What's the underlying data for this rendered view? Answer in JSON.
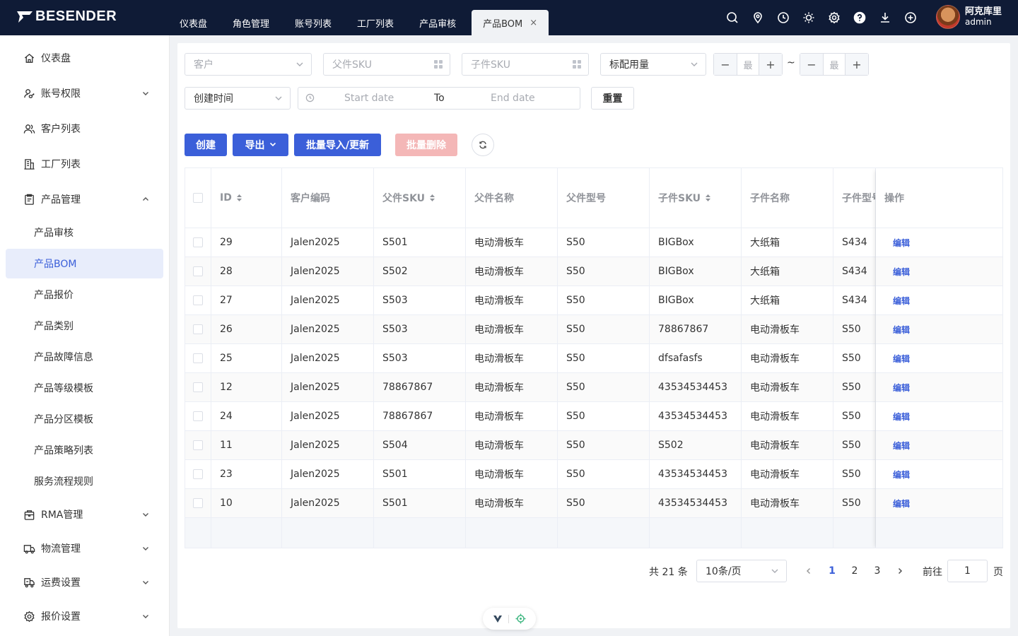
{
  "brand": {
    "name": "BESENDER"
  },
  "top_tabs": [
    {
      "label": "仪表盘"
    },
    {
      "label": "角色管理"
    },
    {
      "label": "账号列表"
    },
    {
      "label": "工厂列表"
    },
    {
      "label": "产品审核"
    },
    {
      "label": "产品BOM",
      "active": true,
      "close": "×"
    }
  ],
  "top_icons": [
    "search-icon",
    "location-icon",
    "clock-icon",
    "sun-icon",
    "gear-icon",
    "help-icon",
    "download-icon",
    "plus-circle-icon"
  ],
  "user": {
    "name": "阿克库里",
    "role": "admin"
  },
  "sidebar": {
    "items": [
      {
        "label": "仪表盘",
        "icon": "home-icon"
      },
      {
        "label": "账号权限",
        "icon": "user-key-icon"
      },
      {
        "label": "客户列表",
        "icon": "users-icon"
      },
      {
        "label": "工厂列表",
        "icon": "building-icon"
      },
      {
        "label": "产品管理",
        "icon": "clipboard-icon"
      }
    ],
    "sub_items": [
      {
        "label": "产品审核"
      },
      {
        "label": "产品BOM",
        "active": true
      },
      {
        "label": "产品报价"
      },
      {
        "label": "产品类别"
      },
      {
        "label": "产品故障信息"
      },
      {
        "label": "产品等级模板"
      },
      {
        "label": "产品分区模板"
      },
      {
        "label": "产品策略列表"
      },
      {
        "label": "服务流程规则"
      }
    ],
    "bottom_items": [
      {
        "label": "RMA管理",
        "icon": "box-icon"
      },
      {
        "label": "物流管理",
        "icon": "truck-icon"
      },
      {
        "label": "运费设置",
        "icon": "freight-icon"
      },
      {
        "label": "报价设置",
        "icon": "gear-icon"
      }
    ]
  },
  "filters": {
    "customer_placeholder": "客户",
    "parent_sku_placeholder": "父件SKU",
    "child_sku_placeholder": "子件SKU",
    "usage_select": "标配用量",
    "min_label": "最",
    "max_label": "最",
    "minus": "−",
    "plus": "+",
    "tilde": "~",
    "created_select": "创建时间",
    "start_date": "Start date",
    "to": "To",
    "end_date": "End date",
    "reset": "重置"
  },
  "actions": {
    "create": "创建",
    "export": "导出",
    "batch_import": "批量导入/更新",
    "batch_delete": "批量删除"
  },
  "table": {
    "headers": [
      "ID",
      "客户编码",
      "父件SKU",
      "父件名称",
      "父件型号",
      "子件SKU",
      "子件名称",
      "子件型号",
      "操作"
    ],
    "edit_label": "编辑",
    "rows": [
      [
        "29",
        "Jalen2025",
        "S501",
        "电动滑板车",
        "S50",
        "BIGBox",
        "大纸箱",
        "S434"
      ],
      [
        "28",
        "Jalen2025",
        "S502",
        "电动滑板车",
        "S50",
        "BIGBox",
        "大纸箱",
        "S434"
      ],
      [
        "27",
        "Jalen2025",
        "S503",
        "电动滑板车",
        "S50",
        "BIGBox",
        "大纸箱",
        "S434"
      ],
      [
        "26",
        "Jalen2025",
        "S503",
        "电动滑板车",
        "S50",
        "78867867",
        "电动滑板车",
        "S50"
      ],
      [
        "25",
        "Jalen2025",
        "S503",
        "电动滑板车",
        "S50",
        "dfsafasfs",
        "电动滑板车",
        "S50"
      ],
      [
        "12",
        "Jalen2025",
        "78867867",
        "电动滑板车",
        "S50",
        "43534534453",
        "电动滑板车",
        "S50"
      ],
      [
        "24",
        "Jalen2025",
        "78867867",
        "电动滑板车",
        "S50",
        "43534534453",
        "电动滑板车",
        "S50"
      ],
      [
        "11",
        "Jalen2025",
        "S504",
        "电动滑板车",
        "S50",
        "S502",
        "电动滑板车",
        "S50"
      ],
      [
        "23",
        "Jalen2025",
        "S501",
        "电动滑板车",
        "S50",
        "43534534453",
        "电动滑板车",
        "S50"
      ],
      [
        "10",
        "Jalen2025",
        "S501",
        "电动滑板车",
        "S50",
        "43534534453",
        "电动滑板车",
        "S50"
      ]
    ]
  },
  "pagination": {
    "total": "共 21 条",
    "page_size": "10条/页",
    "pages": [
      "1",
      "2",
      "3"
    ],
    "current": "1",
    "goto": "前往",
    "goto_value": "1",
    "page_suffix": "页"
  },
  "colors": {
    "topbar": "#0f1b36",
    "primary": "#3b5fd9",
    "danger_disabled": "#f4b7b7"
  }
}
